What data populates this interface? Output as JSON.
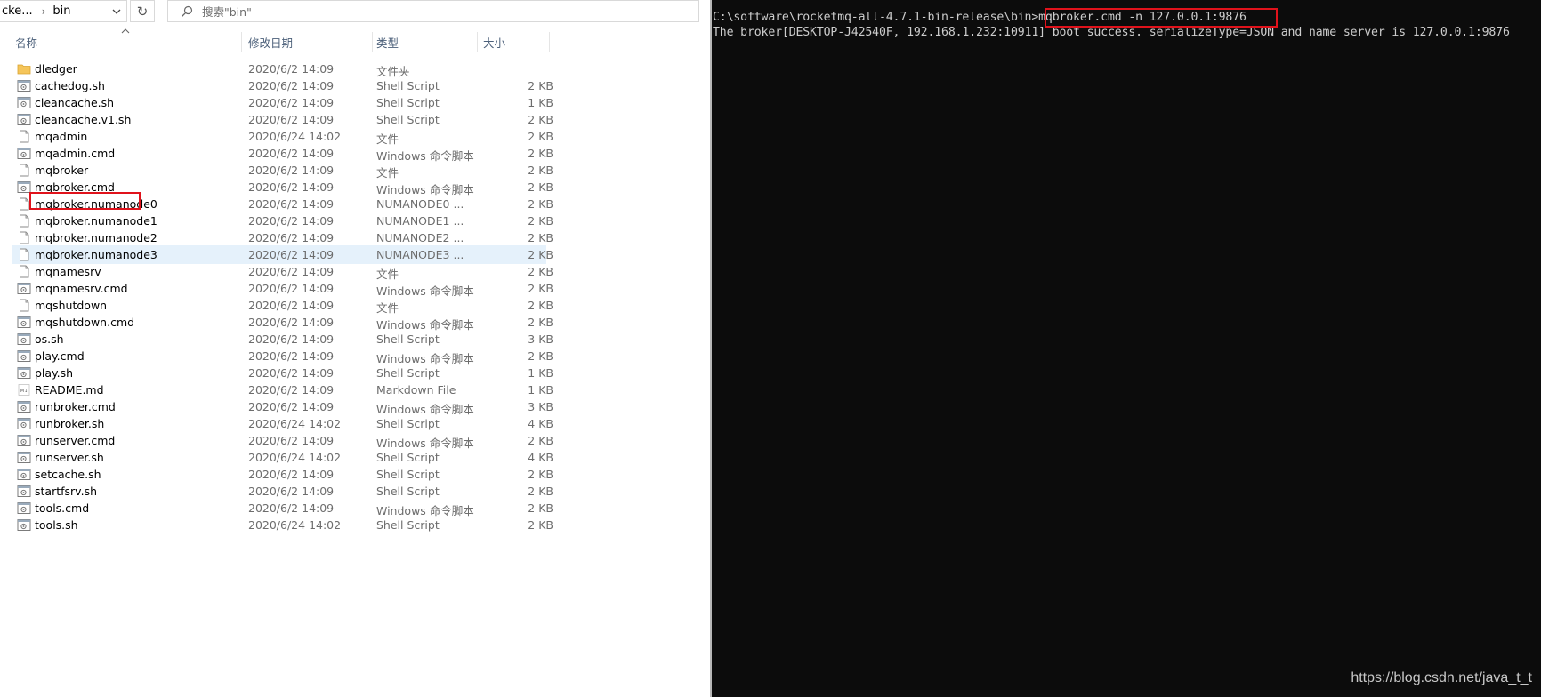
{
  "explorer": {
    "address": {
      "parent": "cke...",
      "current": "bin"
    },
    "search_placeholder": "搜索\"bin\"",
    "columns": {
      "name": "名称",
      "date": "修改日期",
      "type": "类型",
      "size": "大小"
    },
    "files": [
      {
        "name": "dledger",
        "date": "2020/6/2 14:09",
        "type": "文件夹",
        "size": "",
        "icon": "folder-icon"
      },
      {
        "name": "cachedog.sh",
        "date": "2020/6/2 14:09",
        "type": "Shell Script",
        "size": "2 KB",
        "icon": "script-file-icon"
      },
      {
        "name": "cleancache.sh",
        "date": "2020/6/2 14:09",
        "type": "Shell Script",
        "size": "1 KB",
        "icon": "script-file-icon"
      },
      {
        "name": "cleancache.v1.sh",
        "date": "2020/6/2 14:09",
        "type": "Shell Script",
        "size": "2 KB",
        "icon": "script-file-icon"
      },
      {
        "name": "mqadmin",
        "date": "2020/6/24 14:02",
        "type": "文件",
        "size": "2 KB",
        "icon": "blank-file-icon"
      },
      {
        "name": "mqadmin.cmd",
        "date": "2020/6/2 14:09",
        "type": "Windows 命令脚本",
        "size": "2 KB",
        "icon": "script-file-icon"
      },
      {
        "name": "mqbroker",
        "date": "2020/6/2 14:09",
        "type": "文件",
        "size": "2 KB",
        "icon": "blank-file-icon"
      },
      {
        "name": "mqbroker.cmd",
        "date": "2020/6/2 14:09",
        "type": "Windows 命令脚本",
        "size": "2 KB",
        "icon": "script-file-icon"
      },
      {
        "name": "mqbroker.numanode0",
        "date": "2020/6/2 14:09",
        "type": "NUMANODE0 ...",
        "size": "2 KB",
        "icon": "blank-file-icon"
      },
      {
        "name": "mqbroker.numanode1",
        "date": "2020/6/2 14:09",
        "type": "NUMANODE1 ...",
        "size": "2 KB",
        "icon": "blank-file-icon"
      },
      {
        "name": "mqbroker.numanode2",
        "date": "2020/6/2 14:09",
        "type": "NUMANODE2 ...",
        "size": "2 KB",
        "icon": "blank-file-icon"
      },
      {
        "name": "mqbroker.numanode3",
        "date": "2020/6/2 14:09",
        "type": "NUMANODE3 ...",
        "size": "2 KB",
        "icon": "blank-file-icon",
        "selected": true
      },
      {
        "name": "mqnamesrv",
        "date": "2020/6/2 14:09",
        "type": "文件",
        "size": "2 KB",
        "icon": "blank-file-icon"
      },
      {
        "name": "mqnamesrv.cmd",
        "date": "2020/6/2 14:09",
        "type": "Windows 命令脚本",
        "size": "2 KB",
        "icon": "script-file-icon"
      },
      {
        "name": "mqshutdown",
        "date": "2020/6/2 14:09",
        "type": "文件",
        "size": "2 KB",
        "icon": "blank-file-icon"
      },
      {
        "name": "mqshutdown.cmd",
        "date": "2020/6/2 14:09",
        "type": "Windows 命令脚本",
        "size": "2 KB",
        "icon": "script-file-icon"
      },
      {
        "name": "os.sh",
        "date": "2020/6/2 14:09",
        "type": "Shell Script",
        "size": "3 KB",
        "icon": "script-file-icon"
      },
      {
        "name": "play.cmd",
        "date": "2020/6/2 14:09",
        "type": "Windows 命令脚本",
        "size": "2 KB",
        "icon": "script-file-icon"
      },
      {
        "name": "play.sh",
        "date": "2020/6/2 14:09",
        "type": "Shell Script",
        "size": "1 KB",
        "icon": "script-file-icon"
      },
      {
        "name": "README.md",
        "date": "2020/6/2 14:09",
        "type": "Markdown File",
        "size": "1 KB",
        "icon": "markdown-file-icon"
      },
      {
        "name": "runbroker.cmd",
        "date": "2020/6/2 14:09",
        "type": "Windows 命令脚本",
        "size": "3 KB",
        "icon": "script-file-icon"
      },
      {
        "name": "runbroker.sh",
        "date": "2020/6/24 14:02",
        "type": "Shell Script",
        "size": "4 KB",
        "icon": "script-file-icon"
      },
      {
        "name": "runserver.cmd",
        "date": "2020/6/2 14:09",
        "type": "Windows 命令脚本",
        "size": "2 KB",
        "icon": "script-file-icon"
      },
      {
        "name": "runserver.sh",
        "date": "2020/6/24 14:02",
        "type": "Shell Script",
        "size": "4 KB",
        "icon": "script-file-icon"
      },
      {
        "name": "setcache.sh",
        "date": "2020/6/2 14:09",
        "type": "Shell Script",
        "size": "2 KB",
        "icon": "script-file-icon"
      },
      {
        "name": "startfsrv.sh",
        "date": "2020/6/2 14:09",
        "type": "Shell Script",
        "size": "2 KB",
        "icon": "script-file-icon"
      },
      {
        "name": "tools.cmd",
        "date": "2020/6/2 14:09",
        "type": "Windows 命令脚本",
        "size": "2 KB",
        "icon": "script-file-icon"
      },
      {
        "name": "tools.sh",
        "date": "2020/6/24 14:02",
        "type": "Shell Script",
        "size": "2 KB",
        "icon": "script-file-icon"
      }
    ]
  },
  "console": {
    "prompt": "C:\\software\\rocketmq-all-4.7.1-bin-release\\bin>",
    "command": "mqbroker.cmd -n 127.0.0.1:9876",
    "output": "The broker[DESKTOP-J42540F, 192.168.1.232:10911] boot success. serializeType=JSON and name server is 127.0.0.1:9876"
  },
  "watermark": "https://blog.csdn.net/java_t_t",
  "colors": {
    "highlight": "#e0121b",
    "console_bg": "#0c0c0c",
    "console_text": "#cccccc",
    "selected_row": "#e5f1fb"
  }
}
